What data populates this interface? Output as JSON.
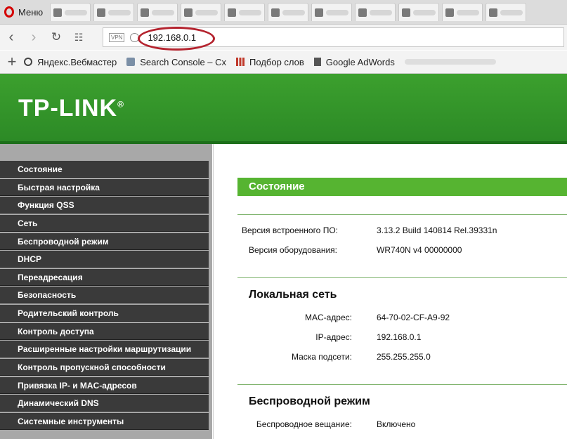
{
  "browser": {
    "menu_label": "Меню",
    "url": "192.168.0.1",
    "vpn_badge": "VPN",
    "bookmarks": [
      "Яндекс.Вебмастер",
      "Search Console – Сх",
      "Подбор слов",
      "Google AdWords"
    ]
  },
  "router": {
    "logo": "TP-LINK",
    "logo_mark": "®",
    "sidebar": [
      "Состояние",
      "Быстрая настройка",
      "Функция QSS",
      "Сеть",
      "Беспроводной режим",
      "DHCP",
      "Переадресация",
      "Безопасность",
      "Родительский контроль",
      "Контроль доступа",
      "Расширенные настройки маршрутизации",
      "Контроль пропускной способности",
      "Привязка IP- и MAC-адресов",
      "Динамический DNS",
      "Системные инструменты"
    ],
    "status": {
      "title": "Состояние",
      "firmware_label": "Версия встроенного ПО:",
      "firmware_value": "3.13.2 Build 140814 Rel.39331n",
      "hardware_label": "Версия оборудования:",
      "hardware_value": "WR740N v4 00000000",
      "lan_title": "Локальная сеть",
      "mac_label": "MAC-адрес:",
      "mac_value": "64-70-02-CF-A9-92",
      "ip_label": "IP-адрес:",
      "ip_value": "192.168.0.1",
      "mask_label": "Маска подсети:",
      "mask_value": "255.255.255.0",
      "wireless_title": "Беспроводной режим",
      "broadcast_label": "Беспроводное вещание:",
      "broadcast_value": "Включено"
    }
  },
  "colors": {
    "header_green": "#3ca02e",
    "section_green": "#56b431",
    "menu_dark": "#3a3a3a",
    "highlight_red": "#b4232e"
  }
}
